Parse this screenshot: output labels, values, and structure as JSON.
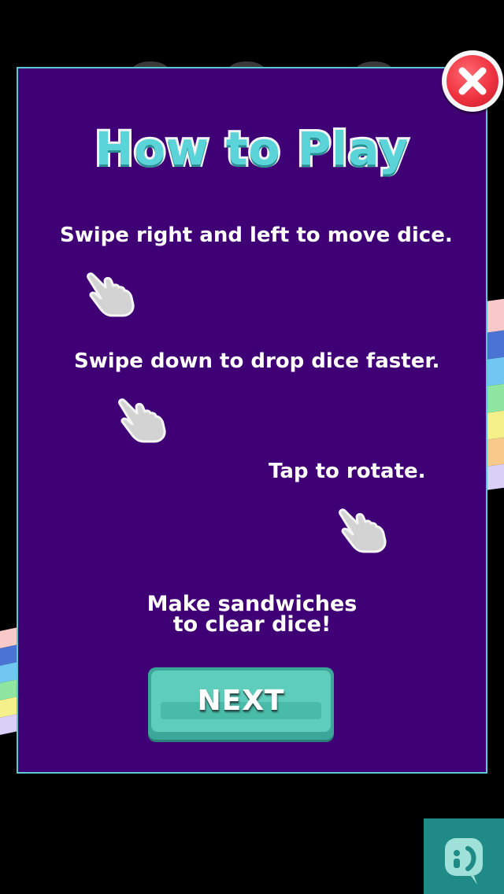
{
  "dialog": {
    "title": "How to Play",
    "instructions": [
      "Swipe right and left to move dice.",
      "Swipe down to drop dice faster.",
      "Tap to rotate."
    ],
    "message_line1": "Make sandwiches",
    "message_line2": "to clear dice!",
    "next_label": "NEXT"
  },
  "icons": {
    "close": "close-icon",
    "hand": "hand-pointer-icon",
    "corner": "chat-badge-icon"
  },
  "colors": {
    "panel_background": "#400075",
    "panel_border": "#5bc7cf",
    "title_fill": "#5ad3d9",
    "button": "#5ecdbc",
    "close_button": "#ef3340",
    "corner_badge": "#1f8a86"
  }
}
